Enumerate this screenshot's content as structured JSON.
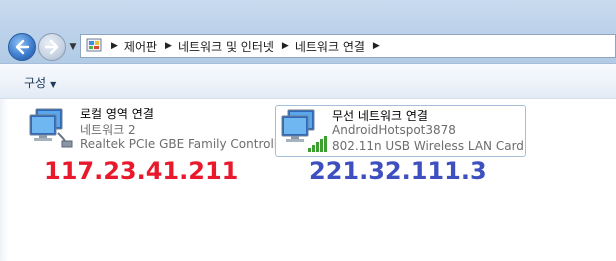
{
  "breadcrumb": [
    "제어판",
    "네트워크 및 인터넷",
    "네트워크 연결"
  ],
  "toolbar": {
    "organize_label": "구성"
  },
  "connections": [
    {
      "name": "로컬 영역 연결",
      "network": "네트워크  2",
      "adapter": "Realtek PCIe GBE Family Controller",
      "annotation": "117.23.41.211",
      "annotation_color": "#e8192c",
      "icon": "wired-network-icon"
    },
    {
      "name": "무선 네트워크 연결",
      "network": "AndroidHotspot3878",
      "adapter": "802.11n USB Wireless LAN Card",
      "annotation": "221.32.111.3",
      "annotation_color": "#3e4fbf",
      "icon": "wireless-network-icon"
    }
  ]
}
